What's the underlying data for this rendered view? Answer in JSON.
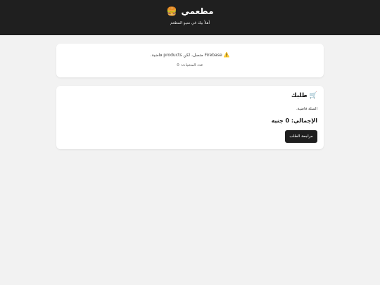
{
  "header": {
    "title": "مطعمي",
    "icon": "burger-icon",
    "icon_glyph": "🍔",
    "tagline": "أهلاً بيك في منيو المطعم"
  },
  "status": {
    "warning_icon": "warning-icon",
    "warning_glyph": "⚠️",
    "message": "Firebase متصل، لكن products فاضية.",
    "count_text": "عدد المنتجات: 0"
  },
  "order": {
    "cart_icon": "cart-icon",
    "cart_glyph": "🛒",
    "title": "طلبك",
    "empty_text": "السلة فاضية.",
    "total_text": "الإجمالي: 0 جنيه",
    "checkout_label": "مراجعة الطلب"
  },
  "colors": {
    "header_bg": "#1f1f1f",
    "page_bg": "#f2f2f2",
    "card_bg": "#ffffff",
    "button_bg": "#1f1f1f"
  }
}
